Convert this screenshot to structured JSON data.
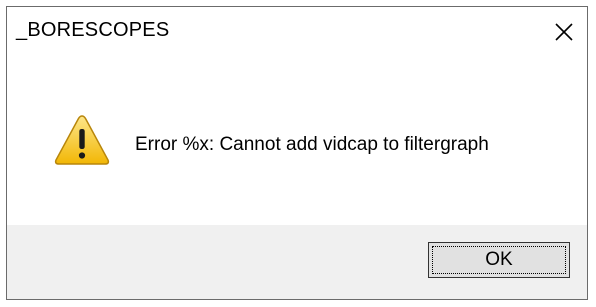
{
  "window": {
    "title": "_BORESCOPES",
    "close_icon": "close-icon"
  },
  "message": {
    "icon": "warning-icon",
    "text": "Error %x: Cannot add vidcap to filtergraph"
  },
  "buttons": {
    "ok_label": "OK"
  },
  "colors": {
    "warning_fill": "#f5c518",
    "warning_outline": "#b8860b",
    "footer_bg": "#f0f0f0",
    "button_bg": "#e1e1e1"
  }
}
